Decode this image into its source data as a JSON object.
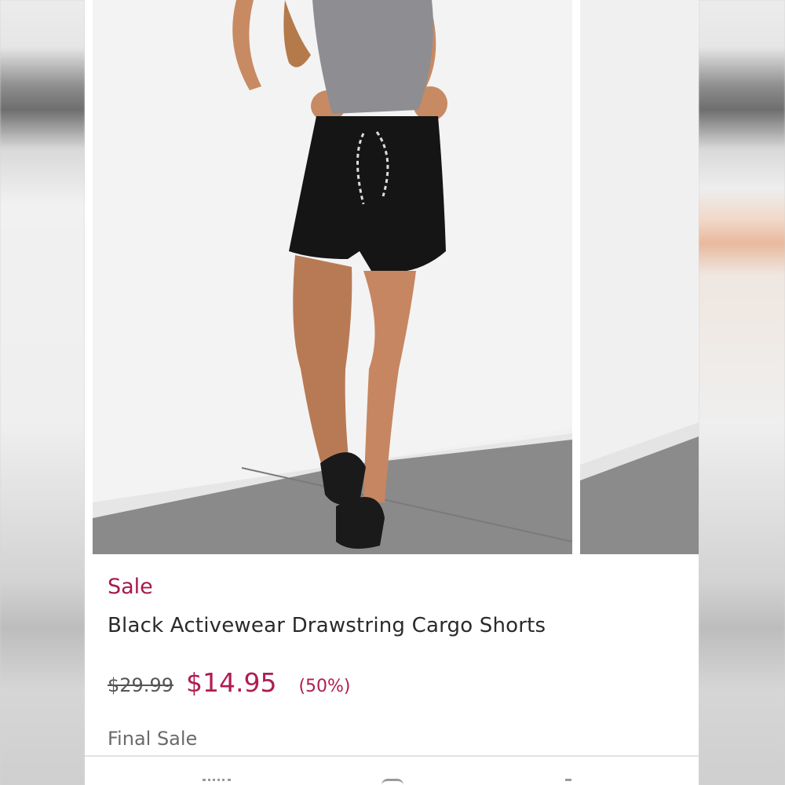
{
  "product": {
    "badge": "Sale",
    "title": "Black Activewear Drawstring Cargo Shorts",
    "price_original": "$29.99",
    "price_sale": "$14.95",
    "discount": "(50%)",
    "note": "Final Sale"
  },
  "colors": {
    "accent": "#b01d53",
    "badge": "#a8184f",
    "text": "#2a2a2a",
    "muted": "#6a6a6a"
  },
  "icons": [
    "menu-icon",
    "instagram-icon",
    "facebook-icon"
  ]
}
